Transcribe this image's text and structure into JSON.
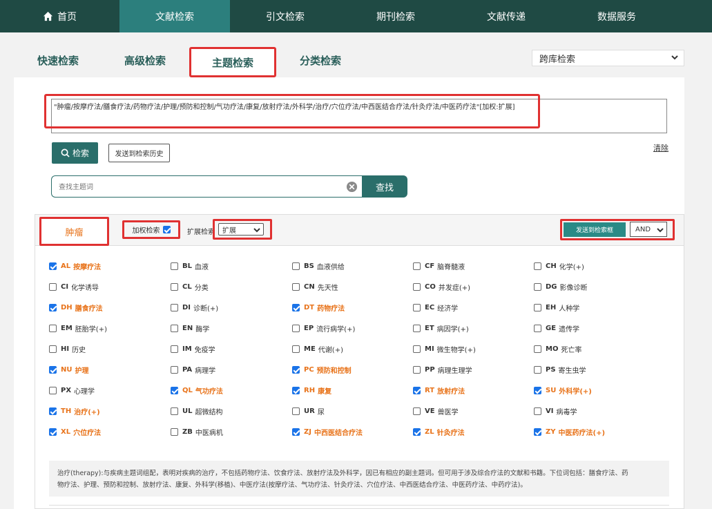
{
  "nav": {
    "items": [
      {
        "label": "首页",
        "active": false
      },
      {
        "label": "文献检索",
        "active": true
      },
      {
        "label": "引文检索",
        "active": false
      },
      {
        "label": "期刊检索",
        "active": false
      },
      {
        "label": "文献传递",
        "active": false
      },
      {
        "label": "数据服务",
        "active": false
      }
    ]
  },
  "search_tabs": [
    "快速检索",
    "高级检索",
    "主题检索",
    "分类检索"
  ],
  "database_select": "跨库检索",
  "query": "\"肿瘤/按摩疗法/膳食疗法/药物疗法/护理/预防和控制/气功疗法/康复/放射疗法/外科学/治疗/穴位疗法/中西医结合疗法/针灸疗法/中医药疗法\"[加权:扩展]",
  "buttons": {
    "search": "检索",
    "send_history": "发送到检索历史",
    "clear": "清除",
    "find": "查找"
  },
  "term_input": {
    "placeholder": "查找主题词",
    "value": ""
  },
  "subheading_panel": {
    "heading": "肿瘤",
    "weighted_label": "加权检索",
    "weighted_checked": true,
    "expand_label": "扩展检索",
    "expand_value": "扩展",
    "send_button": "发送到检索框",
    "operator": "AND"
  },
  "subheadings": [
    {
      "code": "AL",
      "name": "按摩疗法",
      "checked": true
    },
    {
      "code": "BL",
      "name": "血液",
      "checked": false
    },
    {
      "code": "BS",
      "name": "血液供给",
      "checked": false
    },
    {
      "code": "CF",
      "name": "脑脊髓液",
      "checked": false
    },
    {
      "code": "CH",
      "name": "化学(+)",
      "checked": false
    },
    {
      "code": "CI",
      "name": "化学诱导",
      "checked": false
    },
    {
      "code": "CL",
      "name": "分类",
      "checked": false
    },
    {
      "code": "CN",
      "name": "先天性",
      "checked": false
    },
    {
      "code": "CO",
      "name": "并发症(+)",
      "checked": false
    },
    {
      "code": "DG",
      "name": "影像诊断",
      "checked": false
    },
    {
      "code": "DH",
      "name": "膳食疗法",
      "checked": true
    },
    {
      "code": "DI",
      "name": "诊断(+)",
      "checked": false
    },
    {
      "code": "DT",
      "name": "药物疗法",
      "checked": true
    },
    {
      "code": "EC",
      "name": "经济学",
      "checked": false
    },
    {
      "code": "EH",
      "name": "人种学",
      "checked": false
    },
    {
      "code": "EM",
      "name": "胚胎学(+)",
      "checked": false
    },
    {
      "code": "EN",
      "name": "酶学",
      "checked": false
    },
    {
      "code": "EP",
      "name": "流行病学(+)",
      "checked": false
    },
    {
      "code": "ET",
      "name": "病因学(+)",
      "checked": false
    },
    {
      "code": "GE",
      "name": "遗传学",
      "checked": false
    },
    {
      "code": "HI",
      "name": "历史",
      "checked": false
    },
    {
      "code": "IM",
      "name": "免疫学",
      "checked": false
    },
    {
      "code": "ME",
      "name": "代谢(+)",
      "checked": false
    },
    {
      "code": "MI",
      "name": "微生物学(+)",
      "checked": false
    },
    {
      "code": "MO",
      "name": "死亡率",
      "checked": false
    },
    {
      "code": "NU",
      "name": "护理",
      "checked": true
    },
    {
      "code": "PA",
      "name": "病理学",
      "checked": false
    },
    {
      "code": "PC",
      "name": "预防和控制",
      "checked": true
    },
    {
      "code": "PP",
      "name": "病理生理学",
      "checked": false
    },
    {
      "code": "PS",
      "name": "寄生虫学",
      "checked": false
    },
    {
      "code": "PX",
      "name": "心理学",
      "checked": false
    },
    {
      "code": "QL",
      "name": "气功疗法",
      "checked": true
    },
    {
      "code": "RH",
      "name": "康复",
      "checked": true
    },
    {
      "code": "RT",
      "name": "放射疗法",
      "checked": true
    },
    {
      "code": "SU",
      "name": "外科学(+)",
      "checked": true
    },
    {
      "code": "TH",
      "name": "治疗(+)",
      "checked": true
    },
    {
      "code": "UL",
      "name": "超微结构",
      "checked": false
    },
    {
      "code": "UR",
      "name": "尿",
      "checked": false
    },
    {
      "code": "VE",
      "name": "兽医学",
      "checked": false
    },
    {
      "code": "VI",
      "name": "病毒学",
      "checked": false
    },
    {
      "code": "XL",
      "name": "穴位疗法",
      "checked": true
    },
    {
      "code": "ZB",
      "name": "中医病机",
      "checked": false
    },
    {
      "code": "ZJ",
      "name": "中西医结合疗法",
      "checked": true
    },
    {
      "code": "ZL",
      "name": "针灸疗法",
      "checked": true
    },
    {
      "code": "ZY",
      "name": "中医药疗法(+)",
      "checked": true
    }
  ],
  "description": {
    "line1": "治疗(therapy):与疾病主题词组配，表明对疾病的治疗，不包括药物疗法、饮食疗法、放射疗法及外科学，因已有相应的副主题词。但可用于涉及综合疗法的文献和书籍。下位词包括：膳食疗法、药",
    "line2": "物疗法、护理、预防和控制、放射疗法、康复、外科学(移植)、中医疗法(按摩疗法、气功疗法、针灸疗法、穴位疗法、中西医结合疗法、中医药疗法、中药疗法)。"
  },
  "colors": {
    "nav_bg": "#1f4a44",
    "nav_active": "#2c7f7d",
    "accent": "#2a6e6a",
    "checked_text": "#e8731a",
    "highlight": "#e03131"
  }
}
